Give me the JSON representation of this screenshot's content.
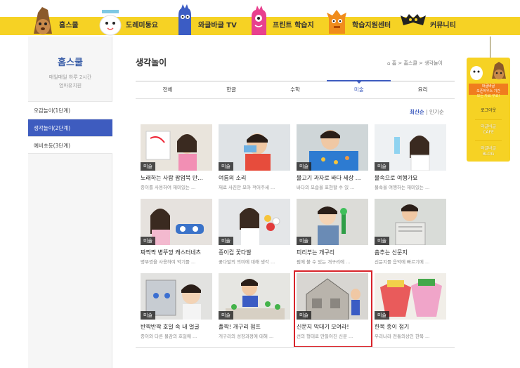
{
  "nav": {
    "items": [
      {
        "label": "홈스쿨",
        "icon": "hedgehog-mascot-icon"
      },
      {
        "label": "도레미동요",
        "icon": "cloud-mascot-icon"
      },
      {
        "label": "와글바글 TV",
        "icon": "blue-monster-icon"
      },
      {
        "label": "프린트 학습지",
        "icon": "pink-monster-icon"
      },
      {
        "label": "학습지원센터",
        "icon": "orange-monster-icon"
      },
      {
        "label": "커뮤니티",
        "icon": "bat-mascot-icon"
      }
    ],
    "band_color": "#f6d224"
  },
  "sidebar": {
    "title": "홈스쿨",
    "subtitle_1": "매일매일 하루 2시간",
    "subtitle_2": "엄마유치원",
    "items": [
      {
        "label": "오감놀이(1단계)",
        "active": false
      },
      {
        "label": "생각놀이(2단계)",
        "active": true
      },
      {
        "label": "예비초등(3단계)",
        "active": false
      }
    ]
  },
  "main": {
    "title": "생각놀이",
    "breadcrumb": "홈 > 홈스쿨 > 생각놀이",
    "tabs": [
      {
        "label": "전체",
        "active": false
      },
      {
        "label": "한글",
        "active": false
      },
      {
        "label": "수학",
        "active": false
      },
      {
        "label": "미술",
        "active": true
      },
      {
        "label": "요리",
        "active": false
      }
    ],
    "sort": {
      "latest": "최신순",
      "sep": "|",
      "popular": "인기순"
    },
    "cards": [
      {
        "tag": "미술",
        "title": "노래하는 사람 팝업북 만...",
        "desc": "종이를 사용하여 재미있는 ...",
        "selected": false
      },
      {
        "tag": "미술",
        "title": "여름의 소리",
        "desc": "재료 사진만 모아 적어주세 ...",
        "selected": false
      },
      {
        "tag": "미술",
        "title": "물고기 과자로 바다 세상 ...",
        "desc": "바다의 모습을 표현할 수 있 ...",
        "selected": false
      },
      {
        "tag": "미술",
        "title": "물속으로 여행가요",
        "desc": "물속을 여행하는 재미있는 ...",
        "selected": false
      },
      {
        "tag": "미술",
        "title": "짜짝짝 병뚜껑 캐스터네츠",
        "desc": "병뚜껑을 사용하여 악기를 ...",
        "selected": false
      },
      {
        "tag": "미술",
        "title": "종이컵 꽃다발",
        "desc": "꽃다발의 의미에 대해 생각 ...",
        "selected": false
      },
      {
        "tag": "미술",
        "title": "피리부는 개구리",
        "desc": "펌에 불 수 있는 개구리에 ...",
        "selected": false
      },
      {
        "tag": "미술",
        "title": "춤추는 신문지",
        "desc": "신문지를 음악에 빠르기에 ...",
        "selected": false
      },
      {
        "tag": "미술",
        "title": "반짝반짝 호일 속 내 얼굴",
        "desc": "종이와 다른 물감의 호일에 ...",
        "selected": false
      },
      {
        "tag": "미술",
        "title": "폴짝! 개구리 점프",
        "desc": "개구리의 성장과정에 대해 ...",
        "selected": false
      },
      {
        "tag": "미술",
        "title": "신문지 막대기 모여라!",
        "desc": "선의 형태로 만들어진 신문 ...",
        "selected": true
      },
      {
        "tag": "미술",
        "title": "한복 종이 접기",
        "desc": "우리나라 전통의상인 한복 ...",
        "selected": false
      }
    ]
  },
  "right_panel": {
    "banner_1": "와글바글",
    "banner_2": "오픈하우스 기간",
    "banner_3": "모든 자료 무료!",
    "logout": "로그아웃",
    "cafe_1": "와글바글",
    "cafe_2": "CAFE",
    "blog_1": "와글바글",
    "blog_2": "BLOG"
  },
  "colors": {
    "accent": "#3e5cbf",
    "highlight": "#d8232a",
    "yellow": "#f6d224"
  }
}
